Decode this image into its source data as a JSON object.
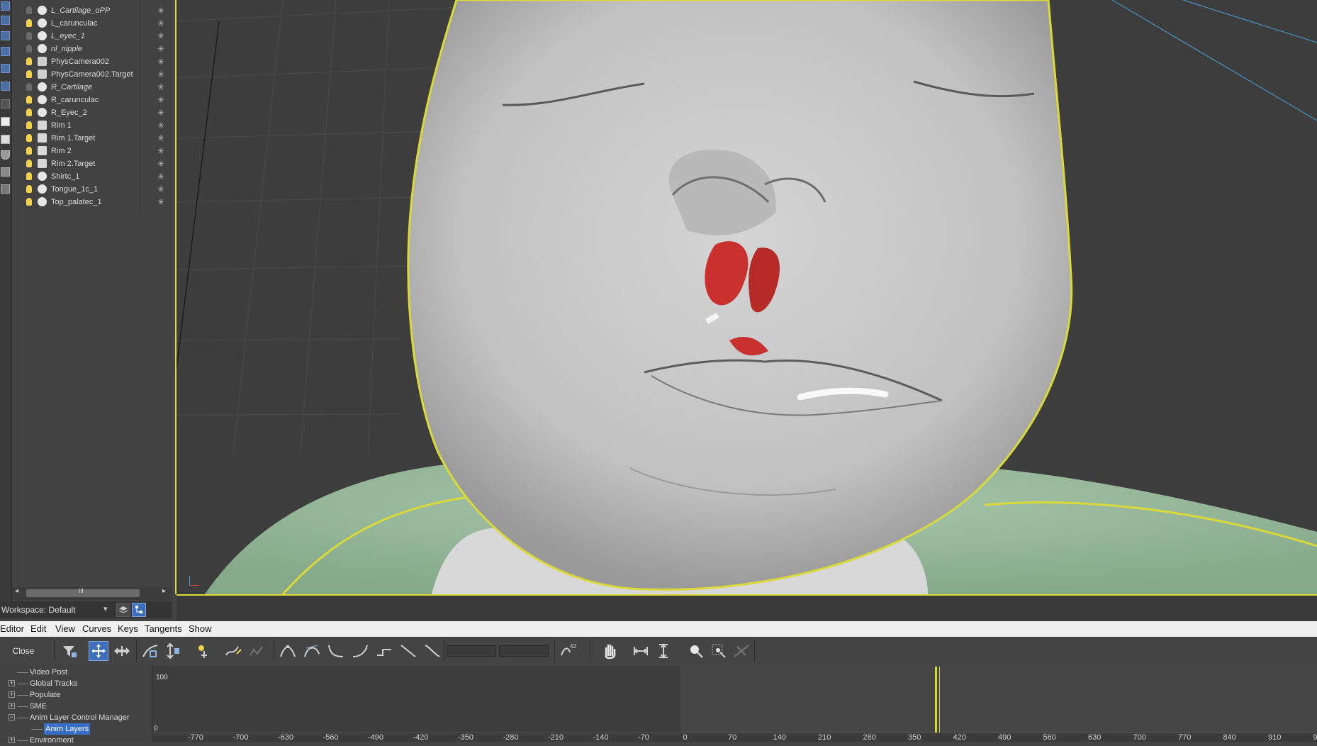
{
  "scene_explorer": {
    "items": [
      {
        "name": "L_Cartilage_oPP",
        "italic": true,
        "light_on": false,
        "icon": "sphere-icon"
      },
      {
        "name": "L_carunculac",
        "italic": false,
        "light_on": true,
        "icon": "sphere-icon"
      },
      {
        "name": "L_eyec_1",
        "italic": true,
        "light_on": false,
        "icon": "sphere-icon"
      },
      {
        "name": "nl_nipple",
        "italic": true,
        "light_on": false,
        "icon": "sphere-icon"
      },
      {
        "name": "PhysCamera002",
        "italic": false,
        "light_on": true,
        "icon": "camera-icon"
      },
      {
        "name": "PhysCamera002.Target",
        "italic": false,
        "light_on": true,
        "icon": "camera-target-icon"
      },
      {
        "name": "R_Cartilage",
        "italic": true,
        "light_on": false,
        "icon": "sphere-icon"
      },
      {
        "name": "R_carunculac",
        "italic": false,
        "light_on": true,
        "icon": "sphere-icon"
      },
      {
        "name": "R_Eyec_2",
        "italic": false,
        "light_on": true,
        "icon": "sphere-icon"
      },
      {
        "name": "Rim 1",
        "italic": false,
        "light_on": true,
        "icon": "spotlight-icon"
      },
      {
        "name": "Rim 1.Target",
        "italic": false,
        "light_on": true,
        "icon": "spotlight-icon"
      },
      {
        "name": "Rim 2",
        "italic": false,
        "light_on": true,
        "icon": "spotlight-icon"
      },
      {
        "name": "Rim 2.Target",
        "italic": false,
        "light_on": true,
        "icon": "spotlight-icon"
      },
      {
        "name": "Shirtc_1",
        "italic": false,
        "light_on": true,
        "icon": "sphere-icon"
      },
      {
        "name": "Tongue_1c_1",
        "italic": false,
        "light_on": true,
        "icon": "sphere-icon"
      },
      {
        "name": "Top_palatec_1",
        "italic": false,
        "light_on": true,
        "icon": "sphere-icon"
      }
    ],
    "freeze_glyph": "✳",
    "scroll_left": "◂",
    "scroll_right": "▸",
    "scroll_grip": "III"
  },
  "workspace": {
    "label": "Workspace: Default",
    "dropdown_arrow": "▾"
  },
  "menu": [
    "Editor",
    "Edit",
    "View",
    "Curves",
    "Keys",
    "Tangents",
    "Show"
  ],
  "toolbar": {
    "close_label": "Close",
    "icons": [
      "filter-icon",
      "move-keys-icon",
      "slide-keys-icon",
      "scale-keys-icon",
      "scale-values-icon",
      "add-keys-icon",
      "draw-curves-icon",
      "reduce-keys-icon",
      "auto-tangent-icon",
      "spline-tangent-icon",
      "fast-tangent-icon",
      "slow-tangent-icon",
      "step-tangent-icon",
      "linear-tangent-icon",
      "smooth-tangent-icon",
      "curve-params-icon",
      "pan-icon",
      "zoom-horizontal-extents-icon",
      "zoom-value-extents-icon",
      "zoom-icon",
      "zoom-region-icon",
      "isolate-curve-icon"
    ]
  },
  "track_tree": [
    {
      "label": "Video Post",
      "expand": "",
      "level": 0
    },
    {
      "label": "Global Tracks",
      "expand": "+",
      "level": 0
    },
    {
      "label": "Populate",
      "expand": "+",
      "level": 0
    },
    {
      "label": "SME",
      "expand": "+",
      "level": 0
    },
    {
      "label": "Anim Layer Control Manager",
      "expand": "−",
      "level": 0
    },
    {
      "label": "Anim Layers",
      "expand": "",
      "level": 1,
      "selected": true
    },
    {
      "label": "Environment",
      "expand": "+",
      "level": 0
    }
  ],
  "curve_editor": {
    "value_top": "100",
    "value_bottom": "0",
    "ruler_ticks": [
      "-770",
      "-700",
      "-630",
      "-560",
      "-490",
      "-420",
      "-350",
      "-280",
      "-210",
      "-140",
      "-70",
      "0",
      "70",
      "140",
      "210",
      "280",
      "350",
      "420",
      "490",
      "560",
      "630",
      "700",
      "770",
      "840",
      "910",
      "9"
    ]
  },
  "colors": {
    "selection_outline": "#d9d93a",
    "skin": "#c8c8c8",
    "shirt": "#9fbfa3",
    "cleft_red": "#c8312e",
    "menu_bg": "#f0f0f0"
  }
}
